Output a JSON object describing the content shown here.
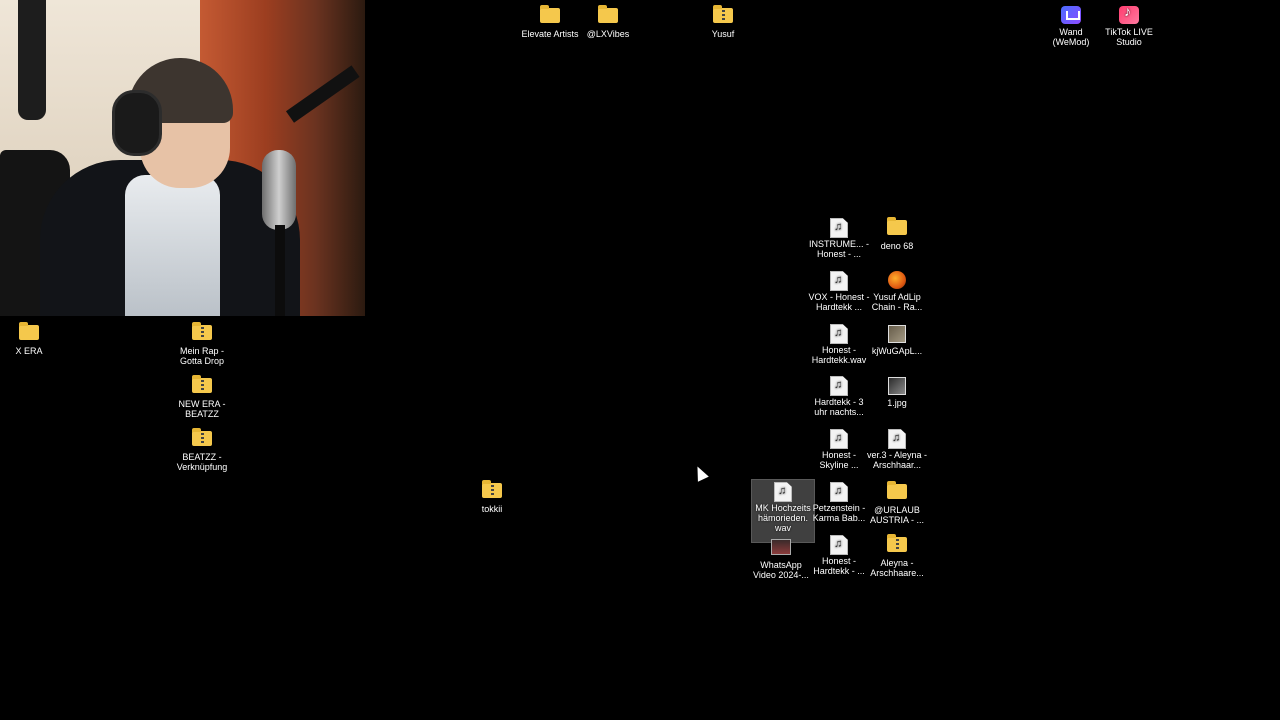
{
  "desktop": {
    "icons": [
      {
        "label": "Elevate Artists"
      },
      {
        "label": "@LXVibes"
      },
      {
        "label": "Yusuf"
      },
      {
        "label": "Wand (WeMod)"
      },
      {
        "label": "TikTok LIVE Studio"
      },
      {
        "label": "X ERA"
      },
      {
        "label": "Mein Rap - Gotta Drop"
      },
      {
        "label": "NEW ERA - BEATZZ"
      },
      {
        "label": "BEATZZ - Verknüpfung"
      },
      {
        "label": "tokkii"
      },
      {
        "label": "INSTRUME... - Honest - ..."
      },
      {
        "label": "deno 68"
      },
      {
        "label": "VOX - Honest - Hardtekk ..."
      },
      {
        "label": "Yusuf AdLip Chain - Ra..."
      },
      {
        "label": "Honest - Hardtekk.wav"
      },
      {
        "label": "kjWuGApL..."
      },
      {
        "label": "Hardtekk - 3 uhr nachts..."
      },
      {
        "label": "1.jpg"
      },
      {
        "label": "Honest - Skyline ..."
      },
      {
        "label": "ver.3 - Aleyna - Arschhaar..."
      },
      {
        "label": "MK Hochzeits hämorieden. wav"
      },
      {
        "label": "Petzenstein - Karma Bab..."
      },
      {
        "label": "@URLAUB AUSTRIA - ..."
      },
      {
        "label": "WhatsApp Video 2024-..."
      },
      {
        "label": "Honest - Hardtekk - ..."
      },
      {
        "label": "Aleyna - Arschhaare..."
      }
    ]
  }
}
